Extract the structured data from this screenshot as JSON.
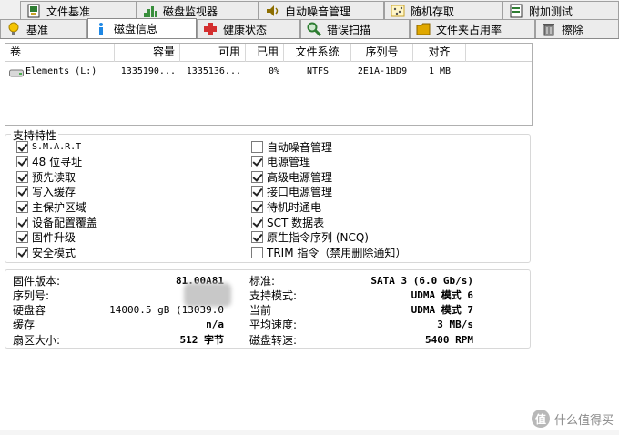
{
  "tabs_top": [
    {
      "label": "文件基准",
      "icon": "file-benchmark-icon",
      "color": "#2e7d32"
    },
    {
      "label": "磁盘监视器",
      "icon": "disk-monitor-icon",
      "color": "#388e3c"
    },
    {
      "label": "自动噪音管理",
      "icon": "speaker-icon",
      "color": "#8d6e00"
    },
    {
      "label": "随机存取",
      "icon": "random-access-icon",
      "color": "#c9a227"
    },
    {
      "label": "附加测试",
      "icon": "extra-tests-icon",
      "color": "#2e7d32"
    }
  ],
  "tabs_bottom": [
    {
      "label": "基准",
      "icon": "bulb-icon",
      "color": "#f5c400"
    },
    {
      "label": "磁盘信息",
      "icon": "info-icon",
      "color": "#1e88e5",
      "active": true
    },
    {
      "label": "健康状态",
      "icon": "health-cross-icon",
      "color": "#d32f2f"
    },
    {
      "label": "错误扫描",
      "icon": "magnifier-icon",
      "color": "#2e7d32"
    },
    {
      "label": "文件夹占用率",
      "icon": "folder-icon",
      "color": "#e0a800"
    },
    {
      "label": "擦除",
      "icon": "trash-icon",
      "color": "#555555"
    }
  ],
  "disk_table": {
    "headers": [
      "卷",
      "容量",
      "可用",
      "已用",
      "文件系统",
      "序列号",
      "对齐"
    ],
    "rows": [
      {
        "volume": "Elements (L:)",
        "capacity": "1335190...",
        "free": "1335136...",
        "used": "0%",
        "fs": "NTFS",
        "serial": "2E1A-1BD9",
        "align": "1 MB"
      }
    ]
  },
  "features": {
    "title": "支持特性",
    "left": [
      {
        "label": "S.M.A.R.T",
        "checked": true,
        "mono": true
      },
      {
        "label": "48 位寻址",
        "checked": true
      },
      {
        "label": "预先读取",
        "checked": true
      },
      {
        "label": "写入缓存",
        "checked": true
      },
      {
        "label": "主保护区域",
        "checked": true
      },
      {
        "label": "设备配置覆盖",
        "checked": true
      },
      {
        "label": "固件升级",
        "checked": true
      },
      {
        "label": "安全模式",
        "checked": true
      }
    ],
    "right": [
      {
        "label": "自动噪音管理",
        "checked": false
      },
      {
        "label": "电源管理",
        "checked": true
      },
      {
        "label": "高级电源管理",
        "checked": true
      },
      {
        "label": "接口电源管理",
        "checked": true
      },
      {
        "label": "待机时通电",
        "checked": true
      },
      {
        "label": "SCT 数据表",
        "checked": true
      },
      {
        "label": "原生指令序列 (NCQ)",
        "checked": true
      },
      {
        "label": "TRIM 指令（禁用删除通知）",
        "checked": false
      }
    ]
  },
  "info": {
    "left": [
      {
        "label": "固件版本:",
        "value": "81.00A81"
      },
      {
        "label": "序列号:",
        "value": ""
      },
      {
        "label": "硬盘容",
        "value": "14000.5 gB (13039.0"
      },
      {
        "label": "缓存",
        "value": "n/a"
      },
      {
        "label": "扇区大小:",
        "value": "512 字节"
      }
    ],
    "right": [
      {
        "label": "标准:",
        "value": "SATA 3 (6.0 Gb/s)"
      },
      {
        "label": "支持模式:",
        "value": "UDMA 模式 6"
      },
      {
        "label": "当前",
        "value": "UDMA 模式 7"
      },
      {
        "label": "平均速度:",
        "value": "3 MB/s"
      },
      {
        "label": "磁盘转速:",
        "value": "5400 RPM"
      }
    ]
  },
  "watermark": {
    "badge": "值",
    "text": "什么值得买"
  }
}
